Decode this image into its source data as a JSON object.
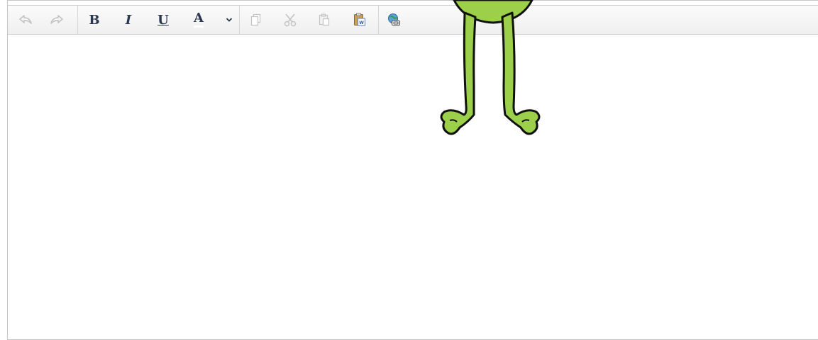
{
  "toolbar": {
    "bold_label": "B",
    "italic_label": "I",
    "underline_label": "U",
    "font_color_label": "A"
  },
  "colors": {
    "toolbar_text": "#2b3650",
    "icon_disabled": "#c3c3c3",
    "font_color_bar": "#ffffff",
    "mascot_green": "#9ccf4a",
    "mascot_outline": "#111111"
  },
  "icons": {
    "undo": "undo-icon",
    "redo": "redo-icon",
    "font_color_dropdown": "chevron-down-icon",
    "copy": "copy-icon",
    "cut": "cut-icon",
    "paste": "paste-icon",
    "paste_word": "paste-from-word-icon",
    "link": "link-icon"
  },
  "editor": {
    "content": ""
  }
}
